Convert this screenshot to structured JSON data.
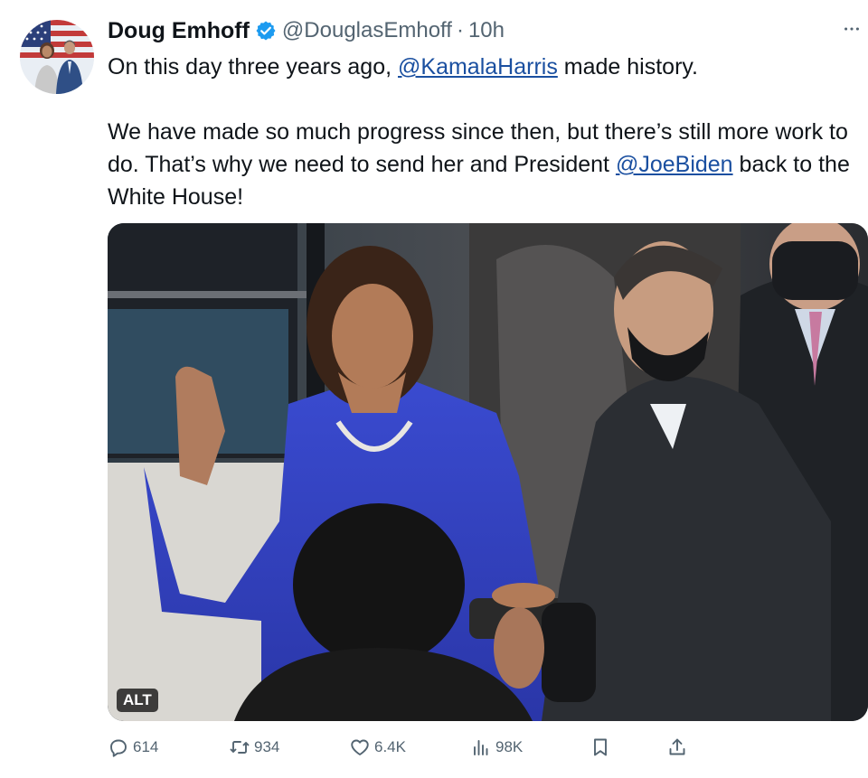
{
  "author": {
    "display_name": "Doug Emhoff",
    "handle": "@DouglasEmhoff",
    "separator": "·",
    "timestamp": "10h",
    "verified": true
  },
  "tweet": {
    "line1_prefix": "On this day three years ago, ",
    "line1_mention": "@KamalaHarris",
    "line1_suffix": " made history.",
    "line2_prefix": "We have made so much progress since then, but there’s still more work to do. That’s why we need to send her and President ",
    "line2_mention": "@JoeBiden",
    "line2_suffix": " back to the White House!"
  },
  "media": {
    "alt_label": "ALT"
  },
  "actions": {
    "replies": "614",
    "reposts": "934",
    "likes": "6.4K",
    "views": "98K"
  },
  "colors": {
    "text": "#0f1419",
    "muted": "#536471",
    "link": "#1a4fa0",
    "verified": "#1d9bf0"
  },
  "icons": [
    "verified-badge-icon",
    "more-icon",
    "reply-icon",
    "repost-icon",
    "like-icon",
    "views-icon",
    "bookmark-icon",
    "share-icon"
  ]
}
